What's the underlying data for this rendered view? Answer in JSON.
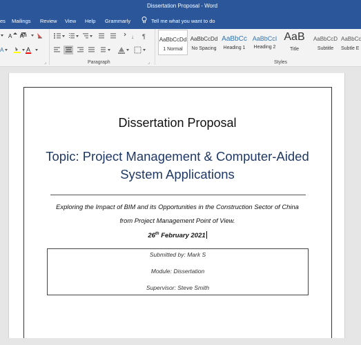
{
  "window": {
    "title": "Dissertation Proposal  -  Word"
  },
  "menu": {
    "tabs": [
      "es",
      "Mailings",
      "Review",
      "View",
      "Help",
      "Grammarly"
    ],
    "tell_me": "Tell me what you want to do"
  },
  "ribbon": {
    "font_tools": {
      "font_size_grow": "Aa",
      "font_color": "A",
      "highlight": "ab"
    },
    "paragraph_label": "Paragraph",
    "styles_label": "Styles",
    "styles": [
      {
        "preview": "AaBbCcDd",
        "name": "1 Normal"
      },
      {
        "preview": "AaBbCcDd",
        "name": "No Spacing"
      },
      {
        "preview": "AaBbCc",
        "name": "Heading 1"
      },
      {
        "preview": "AaBbCcI",
        "name": "Heading 2"
      },
      {
        "preview": "AaB",
        "name": "Title"
      },
      {
        "preview": "AaBbCcD",
        "name": "Subtitle"
      },
      {
        "preview": "AaBbCcD",
        "name": "Subtle E"
      }
    ]
  },
  "document": {
    "title": "Dissertation Proposal",
    "topic_line1": "Topic: Project Management & Computer-Aided",
    "topic_line2": "System Applications",
    "subtitle_line1": "Exploring the Impact of BIM and its Opportunities in the Construction Sector of China",
    "subtitle_line2": "from Project Management Point of View.",
    "date_day": "26",
    "date_suffix": "th",
    "date_rest": " February 2021",
    "submitted_by": "Submitted by: Mark S",
    "module": "Module: Dissertation",
    "supervisor": "Supervisor: Steve Smith"
  },
  "colors": {
    "word_blue": "#2b579a",
    "heading_blue": "#1f3864"
  }
}
